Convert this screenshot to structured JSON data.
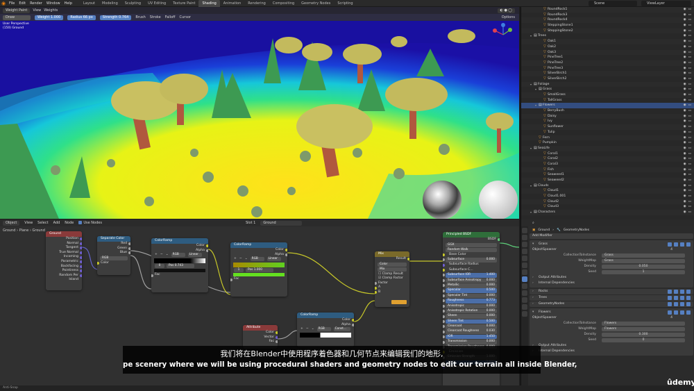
{
  "topbar": {
    "menus": [
      "File",
      "Edit",
      "Render",
      "Window",
      "Help"
    ],
    "workspaces": [
      "Layout",
      "Modeling",
      "Sculpting",
      "UV Editing",
      "Texture Paint",
      "Shading",
      "Animation",
      "Rendering",
      "Compositing",
      "Geometry Nodes",
      "Scripting"
    ],
    "active_workspace": "Shading",
    "scene": "Scene",
    "view_layer": "ViewLayer"
  },
  "viewport": {
    "mode": "Weight Paint",
    "view_menu": "View",
    "weights_menu": "Weights",
    "brush": "Draw",
    "weight_label": "Weight",
    "weight_value": "1.000",
    "radius_label": "Radius",
    "radius_value": "66 px",
    "strength_label": "Strength",
    "strength_value": "0.764",
    "brush_menu": "Brush",
    "stroke_menu": "Stroke",
    "falloff_menu": "Falloff",
    "cursor_menu": "Cursor",
    "options_menu": "Options",
    "info_line1": "User Perspective",
    "info_line2": "(150) Ground"
  },
  "outliner": {
    "rows": [
      {
        "name": "RoundRock1",
        "indent": 3,
        "kind": "obj"
      },
      {
        "name": "RoundRock3",
        "indent": 3,
        "kind": "obj"
      },
      {
        "name": "RoundRock4",
        "indent": 3,
        "kind": "obj"
      },
      {
        "name": "SteppingStone1",
        "indent": 3,
        "kind": "obj"
      },
      {
        "name": "SteppingStone2",
        "indent": 3,
        "kind": "obj"
      },
      {
        "name": "Trees",
        "indent": 1,
        "kind": "col"
      },
      {
        "name": "Oak1",
        "indent": 3,
        "kind": "obj"
      },
      {
        "name": "Oak2",
        "indent": 3,
        "kind": "obj"
      },
      {
        "name": "Oak3",
        "indent": 3,
        "kind": "obj"
      },
      {
        "name": "PineTree1",
        "indent": 3,
        "kind": "obj"
      },
      {
        "name": "PineTree2",
        "indent": 3,
        "kind": "obj"
      },
      {
        "name": "PineTree3",
        "indent": 3,
        "kind": "obj"
      },
      {
        "name": "SilverBirch1",
        "indent": 3,
        "kind": "obj"
      },
      {
        "name": "SilverBirch2",
        "indent": 3,
        "kind": "obj"
      },
      {
        "name": "Foliage",
        "indent": 1,
        "kind": "col"
      },
      {
        "name": "Grass",
        "indent": 2,
        "kind": "col"
      },
      {
        "name": "SmallGrass",
        "indent": 3,
        "kind": "obj"
      },
      {
        "name": "TallGrass",
        "indent": 3,
        "kind": "obj"
      },
      {
        "name": "Flowers",
        "indent": 2,
        "kind": "col",
        "selected": true
      },
      {
        "name": "BerryBush",
        "indent": 3,
        "kind": "obj"
      },
      {
        "name": "Daisy",
        "indent": 3,
        "kind": "obj"
      },
      {
        "name": "Ivy",
        "indent": 3,
        "kind": "obj"
      },
      {
        "name": "Sunflower",
        "indent": 3,
        "kind": "obj"
      },
      {
        "name": "Tulip",
        "indent": 3,
        "kind": "obj"
      },
      {
        "name": "Fern",
        "indent": 2,
        "kind": "obj"
      },
      {
        "name": "Pumpkin",
        "indent": 2,
        "kind": "obj"
      },
      {
        "name": "SeaLife",
        "indent": 1,
        "kind": "col"
      },
      {
        "name": "Coral1",
        "indent": 3,
        "kind": "obj"
      },
      {
        "name": "Coral2",
        "indent": 3,
        "kind": "obj"
      },
      {
        "name": "Coral3",
        "indent": 3,
        "kind": "obj"
      },
      {
        "name": "Fish",
        "indent": 3,
        "kind": "obj"
      },
      {
        "name": "Seaweed1",
        "indent": 3,
        "kind": "obj"
      },
      {
        "name": "Seaweed2",
        "indent": 3,
        "kind": "obj"
      },
      {
        "name": "Clouds",
        "indent": 1,
        "kind": "col"
      },
      {
        "name": "Cloud1",
        "indent": 3,
        "kind": "obj"
      },
      {
        "name": "Cloud1.001",
        "indent": 3,
        "kind": "obj"
      },
      {
        "name": "Cloud2",
        "indent": 3,
        "kind": "obj"
      },
      {
        "name": "Cloud3",
        "indent": 3,
        "kind": "obj"
      },
      {
        "name": "Characters",
        "indent": 1,
        "kind": "col"
      }
    ]
  },
  "node_editor": {
    "mode": "Object",
    "menus": [
      "View",
      "Select",
      "Add",
      "Node"
    ],
    "use_nodes": "Use Nodes",
    "slot": "Slot 1",
    "material": "Ground",
    "breadcrumb": [
      "Ground",
      "Plane",
      "Ground"
    ],
    "nodes": {
      "texcoord": {
        "title": "Ground",
        "outputs": [
          "Position",
          "Normal",
          "Tangent",
          "True Normal",
          "Incoming",
          "Parametric",
          "Backfacing",
          "Pointiness",
          "Random Per Island"
        ]
      },
      "sepcolor": {
        "title": "Separate Color",
        "outputs": [
          "Red",
          "Green",
          "Blue"
        ],
        "mode": "RGB",
        "input": "Color"
      },
      "ramp1": {
        "title": "ColorRamp",
        "outputs": [
          "Color",
          "Alpha"
        ],
        "interp_mode": "RGB",
        "interp": "Linear",
        "stop": "0",
        "pos_label": "Pos",
        "pos": "0.743",
        "input": "Fac"
      },
      "ramp2": {
        "title": "ColorRamp",
        "outputs": [
          "Color",
          "Alpha"
        ],
        "interp_mode": "RGB",
        "interp": "Linear",
        "stop": "1",
        "pos_label": "Pos",
        "pos": "1.000",
        "input": "Fac"
      },
      "mix": {
        "title": "Mix",
        "output": "Result",
        "type": "Color",
        "blend": "Mix",
        "clamp_result": "Clamp Result",
        "clamp_factor": "Clamp Factor",
        "inputs": [
          "Factor",
          "A",
          "B"
        ]
      },
      "ramp3": {
        "title": "ColorRamp",
        "outputs": [
          "Color",
          "Alpha"
        ],
        "interp_mode": "RGB",
        "interp": "Const..."
      },
      "attribute": {
        "title": "Attribute",
        "outputs": [
          "Color",
          "Vector",
          "Fac"
        ]
      },
      "bsdf": {
        "title": "Principled BSDF",
        "output": "BSDF",
        "dist": "GGX",
        "sss": "Random Walk",
        "rows": [
          {
            "label": "Base Color",
            "value": ""
          },
          {
            "label": "Subsurface",
            "value": "0.000"
          },
          {
            "label": "Subsurface Radius",
            "value": ""
          },
          {
            "label": "Subsurface C...",
            "value": ""
          },
          {
            "label": "Subsurface IOR",
            "value": "1.400"
          },
          {
            "label": "Subsurface Anisotropy",
            "value": "0.000"
          },
          {
            "label": "Metallic",
            "value": "0.000"
          },
          {
            "label": "Specular",
            "value": "0.500"
          },
          {
            "label": "Specular Tint",
            "value": "0.000"
          },
          {
            "label": "Roughness",
            "value": "0.773"
          },
          {
            "label": "Anisotropic",
            "value": "0.000"
          },
          {
            "label": "Anisotropic Rotation",
            "value": "0.000"
          },
          {
            "label": "Sheen",
            "value": "0.000"
          },
          {
            "label": "Sheen Tint",
            "value": "0.500"
          },
          {
            "label": "Clearcoat",
            "value": "0.000"
          },
          {
            "label": "Clearcoat Roughness",
            "value": "0.030"
          },
          {
            "label": "IOR",
            "value": "1.450"
          },
          {
            "label": "Transmission",
            "value": "0.000"
          },
          {
            "label": "Transmission Roughness",
            "value": "0.000"
          },
          {
            "label": "Emission",
            "value": ""
          },
          {
            "label": "Emission Strength",
            "value": "1.000"
          },
          {
            "label": "Alpha",
            "value": "1.000"
          },
          {
            "label": "Normal",
            "value": ""
          }
        ]
      }
    }
  },
  "properties": {
    "object": "Ground",
    "modifier_name": "GeometryNodes",
    "add_modifier": "Add Modifier",
    "mods": [
      {
        "name": "Grass",
        "spawner": "ObjectSpawner",
        "spawner_users": "4",
        "collection_label": "CollectionToInstance",
        "collection": "Grass",
        "weightmap_label": "WeightMap",
        "weightmap": "Grass",
        "density_label": "Density",
        "density": "0.050",
        "seed_label": "Seed",
        "seed": "1"
      },
      {
        "name": "Flowers",
        "spawner": "ObjectSpawner",
        "spawner_users": "4",
        "collection_label": "CollectionToInstance",
        "collection": "Flowers",
        "weightmap_label": "WeightMap",
        "weightmap": "Flowers",
        "density_label": "Density",
        "density": "0.300",
        "seed_label": "Seed",
        "seed": "0"
      }
    ],
    "output_attributes": "Output Attributes",
    "internal_deps": "Internal Dependencies",
    "other_mods": [
      "Rocks",
      "Trees",
      "GeometryNodes"
    ]
  },
  "subtitles": {
    "zh": "我们将在Blender中使用程序着色器和几何节点来编辑我们的地形,",
    "en": "pe scenery where we will be using procedural shaders and geometry nodes to edit our terrain all inside Blender,"
  },
  "watermark": "ûdemy",
  "status": "Anti-Snap"
}
